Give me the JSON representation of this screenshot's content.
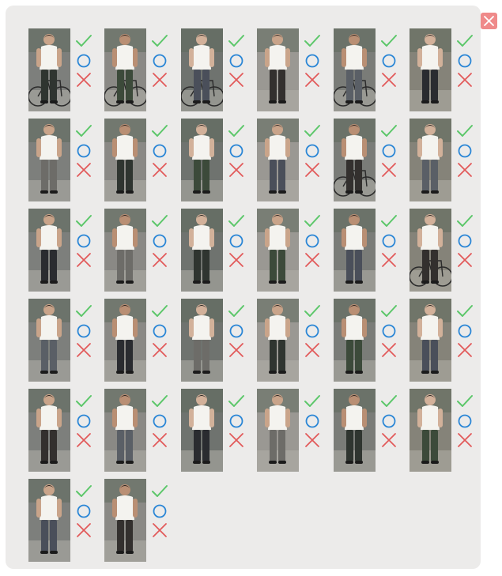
{
  "dialog": {
    "close_icon": "close-x-icon",
    "close_color": "#ef8a8a"
  },
  "action_icons": {
    "accept": {
      "icon": "check-icon",
      "color": "#5cc76a"
    },
    "neutral": {
      "icon": "circle-icon",
      "color": "#2a86d6"
    },
    "reject": {
      "icon": "x-icon",
      "color": "#e25a5a"
    }
  },
  "gallery": {
    "columns": 6,
    "items": [
      {
        "id": 1,
        "icon": "pedestrian-with-bicycle-icon"
      },
      {
        "id": 2,
        "icon": "pedestrian-with-bicycle-icon"
      },
      {
        "id": 3,
        "icon": "pedestrian-with-bicycle-icon"
      },
      {
        "id": 4,
        "icon": "pedestrian-icon"
      },
      {
        "id": 5,
        "icon": "pedestrian-with-bicycle-icon"
      },
      {
        "id": 6,
        "icon": "pedestrian-icon"
      },
      {
        "id": 7,
        "icon": "pedestrian-icon"
      },
      {
        "id": 8,
        "icon": "pedestrian-icon"
      },
      {
        "id": 9,
        "icon": "pedestrian-icon"
      },
      {
        "id": 10,
        "icon": "pedestrian-icon"
      },
      {
        "id": 11,
        "icon": "pedestrian-with-bicycle-icon"
      },
      {
        "id": 12,
        "icon": "pedestrian-icon"
      },
      {
        "id": 13,
        "icon": "pedestrian-icon"
      },
      {
        "id": 14,
        "icon": "pedestrian-icon"
      },
      {
        "id": 15,
        "icon": "pedestrian-icon"
      },
      {
        "id": 16,
        "icon": "pedestrian-icon"
      },
      {
        "id": 17,
        "icon": "pedestrian-icon"
      },
      {
        "id": 18,
        "icon": "pedestrian-with-bicycle-icon"
      },
      {
        "id": 19,
        "icon": "pedestrian-icon"
      },
      {
        "id": 20,
        "icon": "pedestrian-icon"
      },
      {
        "id": 21,
        "icon": "pedestrian-icon"
      },
      {
        "id": 22,
        "icon": "pedestrian-icon"
      },
      {
        "id": 23,
        "icon": "pedestrian-icon"
      },
      {
        "id": 24,
        "icon": "pedestrian-icon"
      },
      {
        "id": 25,
        "icon": "pedestrian-icon"
      },
      {
        "id": 26,
        "icon": "pedestrian-icon"
      },
      {
        "id": 27,
        "icon": "pedestrian-icon"
      },
      {
        "id": 28,
        "icon": "pedestrian-icon"
      },
      {
        "id": 29,
        "icon": "pedestrian-icon"
      },
      {
        "id": 30,
        "icon": "pedestrian-icon"
      },
      {
        "id": 31,
        "icon": "pedestrian-icon"
      },
      {
        "id": 32,
        "icon": "pedestrian-icon"
      }
    ]
  }
}
